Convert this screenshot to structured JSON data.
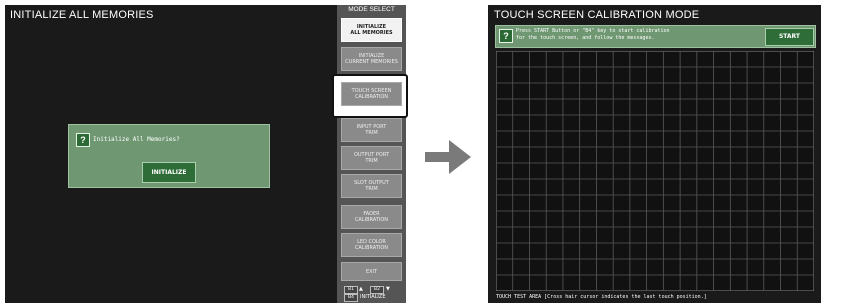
{
  "left_screen": {
    "title": "INITIALIZE ALL MEMORIES",
    "dialog": {
      "icon": "question-icon",
      "message": "Initialize All Memories?",
      "button_label": "INITIALIZE"
    }
  },
  "mode_select": {
    "title": "MODE SELECT",
    "buttons": [
      {
        "label": "INITIALIZE\nALL MEMORIES",
        "active": true
      },
      {
        "label": "INITIALIZE\nCURRENT MEMORIES",
        "active": false
      },
      {
        "label": "TOUCH SCREEN\nCALIBRATION",
        "active": false,
        "highlighted": true
      },
      {
        "label": "INPUT PORT\nTRIM",
        "active": false
      },
      {
        "label": "OUTPUT PORT\nTRIM",
        "active": false
      },
      {
        "label": "SLOT OUTPUT\nTRIM",
        "active": false
      },
      {
        "label": "FADER\nCALIBRATION",
        "active": false
      },
      {
        "label": "LED COLOR\nCALIBRATION",
        "active": false
      },
      {
        "label": "EXIT",
        "active": false
      }
    ],
    "pager": {
      "b1": "B1",
      "b2": "B2",
      "b4": "B4",
      "b4_label": "INITIALIZE"
    }
  },
  "arrow_icon": "right-arrow-icon",
  "right_screen": {
    "title": "TOUCH SCREEN CALIBRATION MODE",
    "message_icon": "question-icon",
    "message_line1": "Press START Button or \"B4\" key to start calibration",
    "message_line2": "for the touch screen, and follow the messages.",
    "start_label": "START",
    "touch_area_label": "TOUCH TEST AREA  [Cross hair cursor indicates the last touch position.]"
  },
  "colors": {
    "screen_bg": "#1a1a1a",
    "dialog_green": "#6f9872",
    "button_green": "#2e6d37",
    "grid_line": "#555555",
    "mode_panel": "#555555"
  }
}
